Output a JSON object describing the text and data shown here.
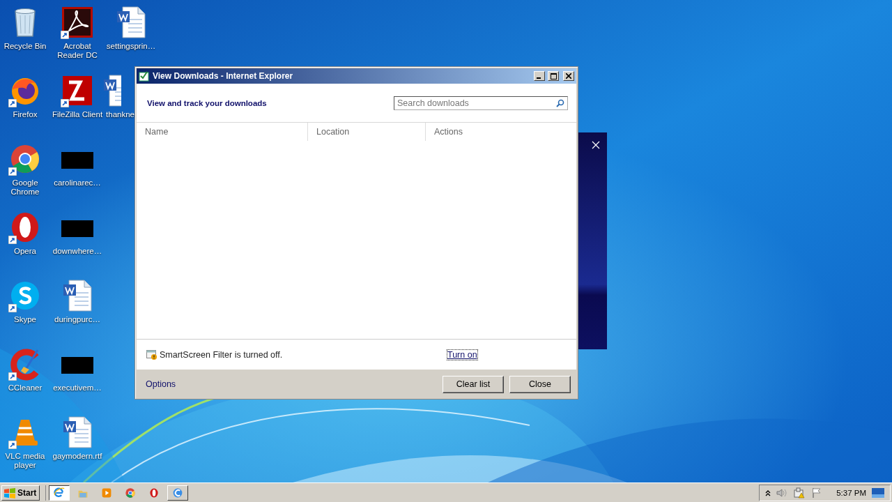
{
  "desktop": {
    "columns": [
      [
        {
          "kind": "recycle-bin",
          "label": "Recycle Bin",
          "shortcut": false
        },
        {
          "kind": "firefox",
          "label": "Firefox",
          "shortcut": true
        },
        {
          "kind": "chrome",
          "label": "Google Chrome",
          "shortcut": true
        },
        {
          "kind": "opera",
          "label": "Opera",
          "shortcut": true
        },
        {
          "kind": "skype",
          "label": "Skype",
          "shortcut": true
        },
        {
          "kind": "ccleaner",
          "label": "CCleaner",
          "shortcut": true
        },
        {
          "kind": "vlc",
          "label": "VLC media player",
          "shortcut": true
        }
      ],
      [
        {
          "kind": "pdf",
          "label": "Acrobat Reader DC",
          "shortcut": true
        },
        {
          "kind": "filezilla",
          "label": "FileZilla Client",
          "shortcut": true
        },
        {
          "kind": "redacted",
          "label": "carolinarec…",
          "shortcut": false
        },
        {
          "kind": "redacted",
          "label": "downwhere…",
          "shortcut": false
        },
        {
          "kind": "word",
          "label": "duringpurc…",
          "shortcut": false
        },
        {
          "kind": "redacted",
          "label": "executivem…",
          "shortcut": false
        },
        {
          "kind": "word",
          "label": "gaymodern.rtf",
          "shortcut": false
        }
      ],
      [
        {
          "kind": "word",
          "label": "settingsprin…",
          "shortcut": false
        },
        {
          "kind": "word",
          "label": "thankne",
          "shortcut": false
        }
      ]
    ]
  },
  "dialog": {
    "title": "View Downloads - Internet Explorer",
    "heading": "View and track your downloads",
    "search": {
      "placeholder": "Search downloads"
    },
    "columns": [
      "Name",
      "Location",
      "Actions"
    ],
    "notice": {
      "text": "SmartScreen Filter is turned off.",
      "link": "Turn on",
      "focused": true
    },
    "options_link": "Options",
    "buttons": [
      "Clear list",
      "Close"
    ]
  },
  "taskbar": {
    "start": "Start",
    "apps": [
      {
        "kind": "ie",
        "selected": true,
        "running": false
      },
      {
        "kind": "folder",
        "selected": false,
        "running": false
      },
      {
        "kind": "media",
        "selected": false,
        "running": false
      },
      {
        "kind": "chrome",
        "selected": false,
        "running": false
      },
      {
        "kind": "opera",
        "selected": false,
        "running": false
      },
      {
        "kind": "swirl",
        "selected": false,
        "running": true
      }
    ],
    "clock": "5:37 PM"
  }
}
